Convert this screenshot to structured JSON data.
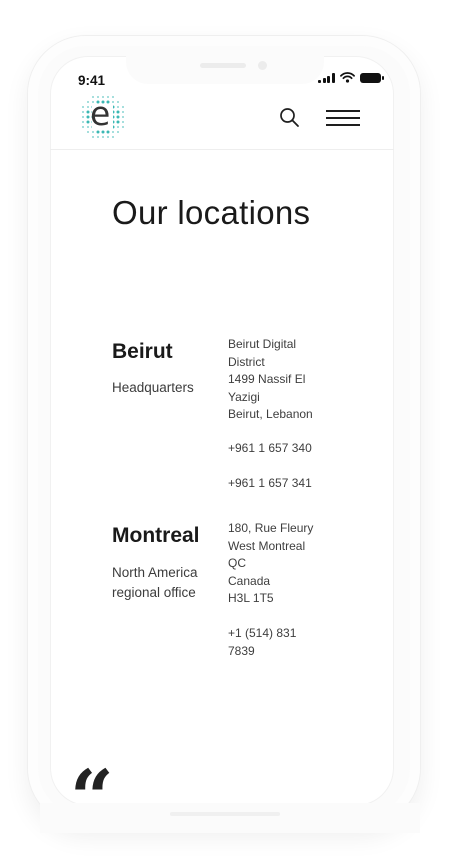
{
  "status_bar": {
    "time": "9:41"
  },
  "header": {
    "logo_letter": "e",
    "brand_color": "#3bb8b4",
    "icons": {
      "search": "search-icon",
      "menu": "hamburger-menu-icon"
    }
  },
  "page": {
    "title": "Our locations"
  },
  "locations": [
    {
      "city": "Beirut",
      "role": "Headquarters",
      "address_lines": [
        "Beirut Digital",
        "District",
        "1499 Nassif El",
        "Yazigi",
        "Beirut, Lebanon"
      ],
      "phones": [
        "+961 1 657 340",
        "+961 1 657 341"
      ]
    },
    {
      "city": "Montreal",
      "role": "North America regional office",
      "address_lines": [
        "180, Rue Fleury",
        "West Montreal",
        "QC",
        "Canada",
        "H3L 1T5"
      ],
      "phones": [
        "+1 (514) 831 7839"
      ]
    }
  ],
  "quote": {
    "mark": "“"
  }
}
